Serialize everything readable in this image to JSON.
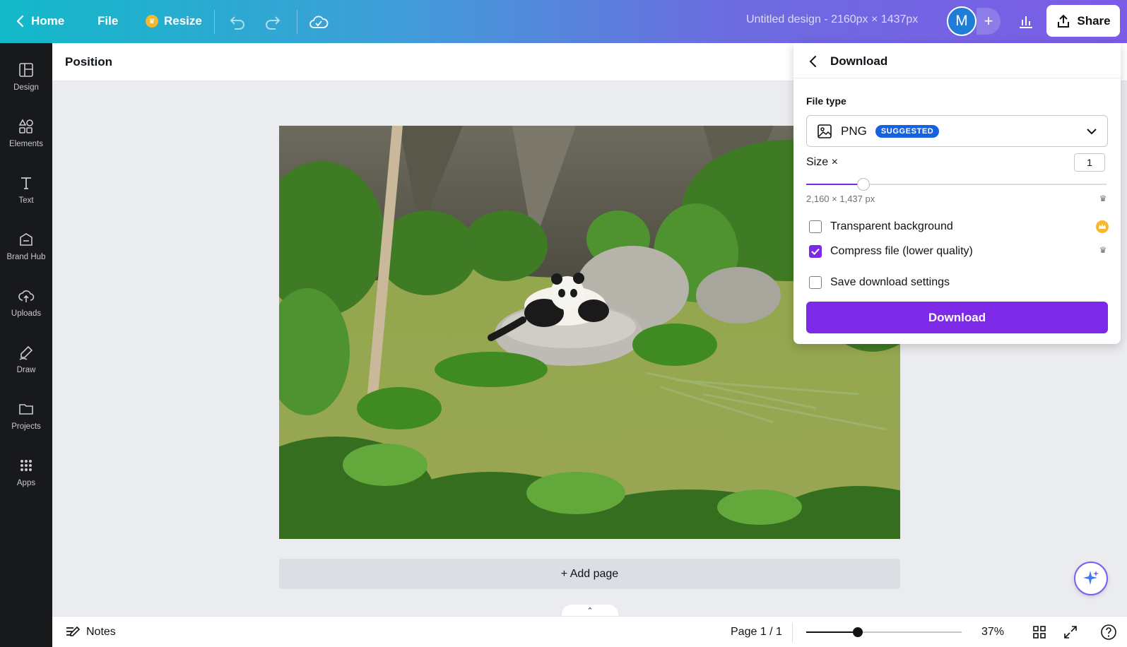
{
  "topbar": {
    "home_label": "Home",
    "file_label": "File",
    "resize_label": "Resize",
    "doc_title": "Untitled design - 2160px × 1437px",
    "avatar_initial": "M",
    "share_label": "Share"
  },
  "sidebar": {
    "items": [
      {
        "label": "Design",
        "icon": "layout-icon"
      },
      {
        "label": "Elements",
        "icon": "shapes-icon"
      },
      {
        "label": "Text",
        "icon": "text-icon"
      },
      {
        "label": "Brand Hub",
        "icon": "brand-hub-icon"
      },
      {
        "label": "Uploads",
        "icon": "cloud-upload-icon"
      },
      {
        "label": "Draw",
        "icon": "draw-icon"
      },
      {
        "label": "Projects",
        "icon": "folder-icon"
      },
      {
        "label": "Apps",
        "icon": "apps-grid-icon"
      }
    ]
  },
  "context_bar": {
    "position_label": "Position"
  },
  "canvas": {
    "add_page_label": "+ Add page",
    "image_subject": "panda-photo"
  },
  "bottombar": {
    "notes_label": "Notes",
    "page_info": "Page 1 / 1",
    "zoom_percent": "37%",
    "zoom_value": 0.33
  },
  "download_panel": {
    "title": "Download",
    "file_type_label": "File type",
    "file_type_value": "PNG",
    "suggested_badge": "SUGGESTED",
    "size_label": "Size ×",
    "size_value": "1",
    "size_slider_value": 0.19,
    "dimensions": "2,160 × 1,437 px",
    "options": [
      {
        "label": "Transparent background",
        "checked": false
      },
      {
        "label": "Compress file (lower quality)",
        "checked": true
      },
      {
        "label": "Save download settings",
        "checked": false
      }
    ],
    "download_button": "Download"
  },
  "colors": {
    "accent_purple": "#7d2ae8",
    "badge_blue": "#1661e0",
    "pro_gold": "#f5b82e",
    "sidebar_bg": "#18191b"
  }
}
